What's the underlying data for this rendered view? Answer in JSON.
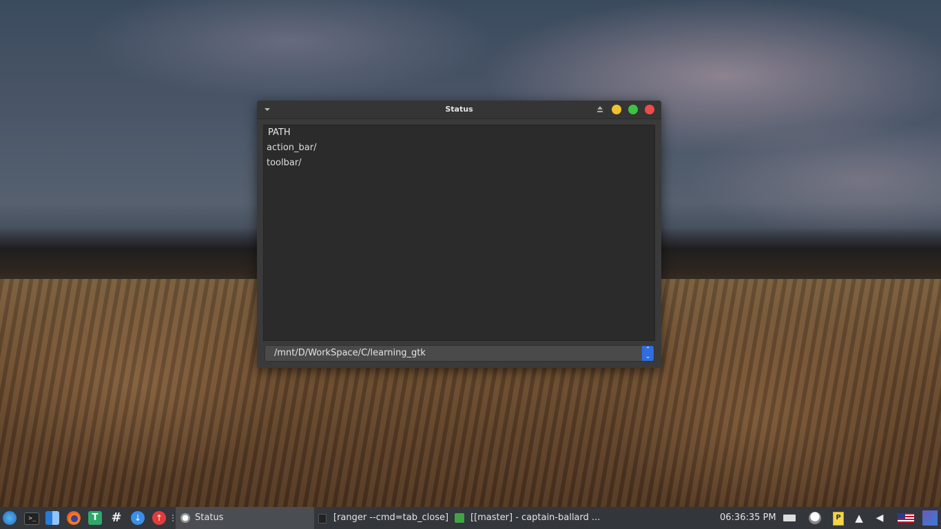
{
  "window": {
    "title": "Status",
    "list": {
      "column_header": "PATH",
      "rows": [
        "action_bar/",
        "toolbar/"
      ]
    },
    "path_combo": {
      "value": "/mnt/D/WorkSpace/C/learning_gtk"
    },
    "controls": {
      "minimize_color": "#f5c02e",
      "maximize_color": "#3ac43f",
      "close_color": "#ef4b4b"
    }
  },
  "taskbar": {
    "launchers": [
      "deepin-logo-icon",
      "terminal-icon",
      "file-manager-icon",
      "firefox-icon",
      "text-editor-icon",
      "slack-icon",
      "downloader-icon",
      "upload-icon"
    ],
    "tasks": [
      {
        "label": "Status",
        "icon": "window-app-icon",
        "active": true
      },
      {
        "label": "[ranger --cmd=tab_close]",
        "icon": "terminal-app-icon",
        "active": false
      },
      {
        "label": "[[master] - captain-ballard ...",
        "icon": "qt-creator-icon",
        "active": false
      }
    ],
    "clock": "06:36:35 PM",
    "tray": [
      "battery-icon",
      "network-icon",
      "clipboard-icon",
      "notification-bell-icon",
      "volume-icon",
      "us-flag-icon",
      "workspace-icon"
    ]
  }
}
